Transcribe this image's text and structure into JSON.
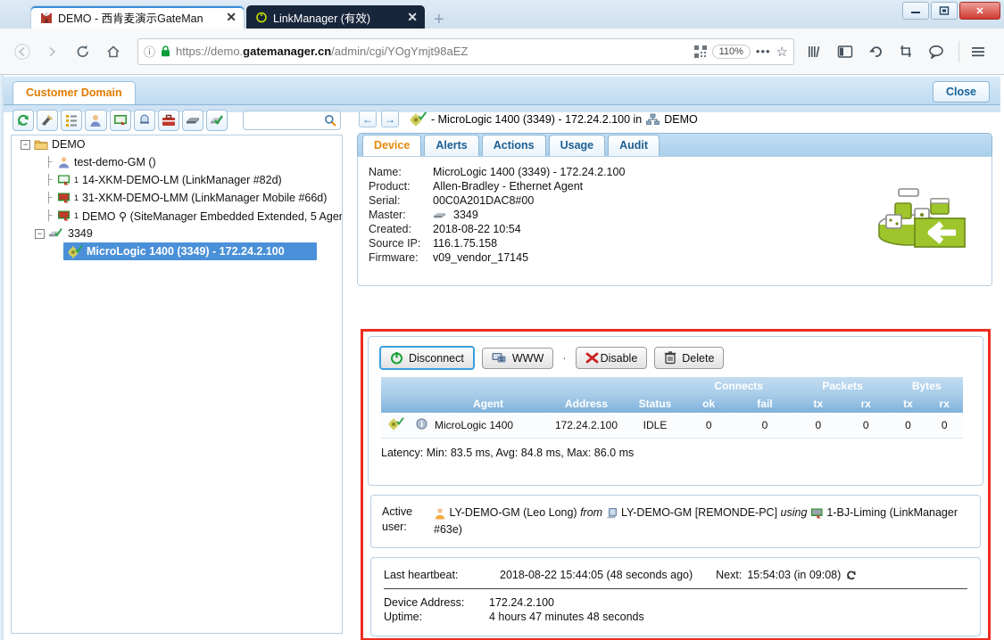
{
  "browser": {
    "tabs": [
      {
        "title": "DEMO - 西肯麦演示GateMan",
        "active": true,
        "favicon": "castle-icon",
        "close_label": "✕"
      },
      {
        "title": "LinkManager (有效)",
        "active": false,
        "favicon": "power-icon",
        "close_label": "✕"
      }
    ],
    "new_tab_label": "+",
    "window_controls": {
      "minimize": "—",
      "maximize": "❐",
      "close": "✕"
    },
    "nav": {
      "back": "←",
      "forward": "→",
      "reload": "⟳",
      "home": "⌂",
      "info_icon": "ⓘ",
      "lock_icon": "lock-icon",
      "url_scheme": "https://demo.",
      "url_host": "gatemanager.cn",
      "url_path": "/admin/cgi/YOgYmjt98aEZ",
      "qr_icon": "qr-icon",
      "zoom_level": "110%",
      "more_label": "•••",
      "bookmark_star": "☆",
      "library": "library-icon",
      "sidebar": "sidebar-icon",
      "undo": "↶",
      "screenshot": "crop-icon",
      "chat": "chat-icon",
      "menu": "☰"
    }
  },
  "app": {
    "domain_tab_label": "Customer Domain",
    "close_button_label": "Close",
    "toolbar": [
      {
        "name": "refresh-icon",
        "glyph": "refresh"
      },
      {
        "name": "tools-icon",
        "glyph": "tools"
      },
      {
        "name": "list-icon",
        "glyph": "list"
      },
      {
        "name": "user-icon",
        "glyph": "user"
      },
      {
        "name": "monitor-icon",
        "glyph": "monitor"
      },
      {
        "name": "alert-bell-icon",
        "glyph": "bell"
      },
      {
        "name": "toolbox-icon",
        "glyph": "toolbox"
      },
      {
        "name": "appliance-icon",
        "glyph": "appliance"
      },
      {
        "name": "appliance-ok-icon",
        "glyph": "appliance-ok"
      }
    ],
    "search": {
      "value": "",
      "placeholder": "",
      "icon": "search-icon"
    }
  },
  "tree": {
    "root": {
      "label": "DEMO",
      "icon": "folder-icon",
      "expander": "−"
    },
    "items": [
      {
        "label": "test-demo-GM ()",
        "icon": "user-icon",
        "sup": ""
      },
      {
        "label": "14-XKM-DEMO-LM (LinkManager #82d)",
        "icon": "linkmanager-green-icon",
        "sup": "1"
      },
      {
        "label": "31-XKM-DEMO-LMM (LinkManager Mobile #66d)",
        "icon": "linkmanager-red-icon",
        "sup": "1"
      },
      {
        "label": "DEMO ⚲ (SiteManager Embedded Extended, 5 Ager",
        "icon": "sitemanager-icon",
        "sup": "1"
      }
    ],
    "group": {
      "label": "3349",
      "icon": "appliance-ok-icon",
      "expander": "−"
    },
    "selected": {
      "label": "MicroLogic 1400 (3349) - 172.24.2.100",
      "icon": "gear-ok-icon"
    }
  },
  "detail": {
    "breadcrumb": {
      "back": "←",
      "forward": "→",
      "icon": "gear-ok-icon",
      "text": "- MicroLogic 1400 (3349) - 172.24.2.100 in",
      "domain_icon": "domain-icon",
      "domain": "DEMO"
    },
    "tabs": [
      {
        "label": "Device",
        "active": true
      },
      {
        "label": "Alerts",
        "active": false
      },
      {
        "label": "Actions",
        "active": false
      },
      {
        "label": "Usage",
        "active": false
      },
      {
        "label": "Audit",
        "active": false
      }
    ],
    "info": [
      {
        "key": "Name:",
        "value": "MicroLogic 1400 (3349) - 172.24.2.100"
      },
      {
        "key": "Product:",
        "value": "Allen-Bradley - Ethernet Agent"
      },
      {
        "key": "Serial:",
        "value": "00C0A201DAC8#00"
      },
      {
        "key": "Master:",
        "value": "3349",
        "icon": "appliance-icon"
      },
      {
        "key": "Created:",
        "value": "2018-08-22 10:54"
      },
      {
        "key": "Source IP:",
        "value": "116.1.75.158"
      },
      {
        "key": "Firmware:",
        "value": "v09_vendor_17145"
      }
    ],
    "device_image": "conveyor-icon",
    "buttons": [
      {
        "label": "Disconnect",
        "icon": "power-icon",
        "primary": true
      },
      {
        "label": "WWW",
        "icon": "www-icon",
        "primary": false
      },
      {
        "label": "Disable",
        "icon": "x-red-icon",
        "primary": false
      },
      {
        "label": "Delete",
        "icon": "trash-icon",
        "primary": false
      }
    ],
    "button_separator": "·",
    "table": {
      "group_headers": [
        {
          "label": "",
          "span": 4
        },
        {
          "label": "Connects",
          "span": 2
        },
        {
          "label": "Packets",
          "span": 2
        },
        {
          "label": "Bytes",
          "span": 2
        }
      ],
      "headers": [
        "",
        "Agent",
        "Address",
        "Status",
        "ok",
        "fail",
        "tx",
        "rx",
        "tx",
        "rx"
      ],
      "rows": [
        {
          "icon": "gear-ok-icon",
          "info_icon": "info-icon",
          "agent": "MicroLogic 1400",
          "address": "172.24.2.100",
          "status": "IDLE",
          "connects_ok": "0",
          "connects_fail": "0",
          "packets_tx": "0",
          "packets_rx": "0",
          "bytes_tx": "0",
          "bytes_rx": "0"
        }
      ]
    },
    "latency": "Latency: Min: 83.5 ms, Avg: 84.8 ms, Max: 86.0 ms",
    "active_user": {
      "label": "Active user:",
      "user_icon": "user-icon",
      "user": "LY-DEMO-GM (Leo Long)",
      "from_word": "from",
      "host_icon": "computer-icon",
      "host": "LY-DEMO-GM [REMONDE-PC]",
      "using_word": "using",
      "lm_icon": "linkmanager-red-icon",
      "lm": "1-BJ-Liming (LinkManager #63e)"
    },
    "heartbeat": {
      "label": "Last heartbeat:",
      "value": "2018-08-22 15:44:05 (48 seconds ago)",
      "next_label": "Next:",
      "next_value": "15:54:03 (in 09:08)",
      "refresh_icon": "refresh-small-icon",
      "rows": [
        {
          "key": "Device Address:",
          "value": "172.24.2.100"
        },
        {
          "key": "Uptime:",
          "value": "4 hours 47 minutes 48 seconds"
        }
      ]
    }
  },
  "colors": {
    "accent_orange": "#e8890c",
    "tab_blue": "#1b5e92",
    "highlight_blue": "#4a90d9",
    "red_box": "#ee2b1f",
    "green": "#5ca800"
  }
}
